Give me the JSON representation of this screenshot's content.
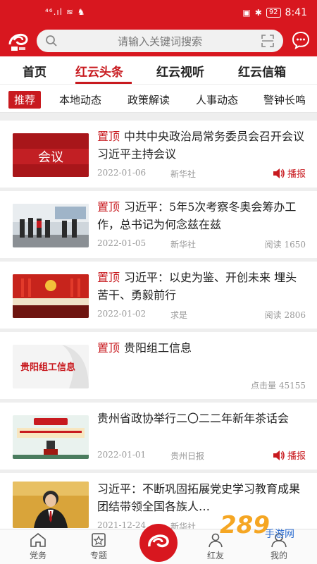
{
  "status": {
    "left": "⁴⁶.ıl ≋ ♞",
    "battery": "92",
    "time": "8:41"
  },
  "search": {
    "placeholder": "请输入关键词搜索"
  },
  "tabs": [
    {
      "label": "首页"
    },
    {
      "label": "红云头条"
    },
    {
      "label": "红云视听"
    },
    {
      "label": "红云信箱"
    }
  ],
  "subtabs": [
    {
      "label": "推荐"
    },
    {
      "label": "本地动态"
    },
    {
      "label": "政策解读"
    },
    {
      "label": "人事动态"
    },
    {
      "label": "警钟长鸣"
    }
  ],
  "feed": [
    {
      "pin": "置顶",
      "title": "中共中央政治局常务委员会召开会议 习近平主持会议",
      "date": "2022-01-06",
      "source": "新华社",
      "action": "播报",
      "thumb_text": "会议"
    },
    {
      "pin": "置顶",
      "title": "习近平：5年5次考察冬奥会筹办工作，总书记为何念兹在兹",
      "date": "2022-01-05",
      "source": "新华社",
      "reads": "阅读 1650"
    },
    {
      "pin": "置顶",
      "title": "习近平：以史为鉴、开创未来 埋头苦干、勇毅前行",
      "date": "2022-01-02",
      "source": "求是",
      "reads": "阅读 2806"
    },
    {
      "pin": "置顶",
      "title": "贵阳组工信息",
      "date": "",
      "source": "",
      "reads": "点击量 45155",
      "thumb_text": "贵阳组工信息"
    },
    {
      "pin": "",
      "title": "贵州省政协举行二〇二二年新年茶话会",
      "date": "2022-01-01",
      "source": "贵州日报",
      "action": "播报"
    },
    {
      "pin": "",
      "title": "习近平：不断巩固拓展党史学习教育成果 团结带领全国各族人…",
      "date": "2021-12-24",
      "source": "新华社"
    }
  ],
  "bottom_nav": [
    {
      "label": "党务",
      "icon": "home-icon"
    },
    {
      "label": "专题",
      "icon": "topic-icon"
    },
    {
      "label": "",
      "icon": "app-logo-icon"
    },
    {
      "label": "红友",
      "icon": "friends-icon"
    },
    {
      "label": "我的",
      "icon": "profile-icon"
    }
  ],
  "watermark": {
    "brand": "289",
    "sub": "手游网"
  },
  "colors": {
    "brand_red": "#d8171f",
    "accent_red": "#c81a1f"
  }
}
